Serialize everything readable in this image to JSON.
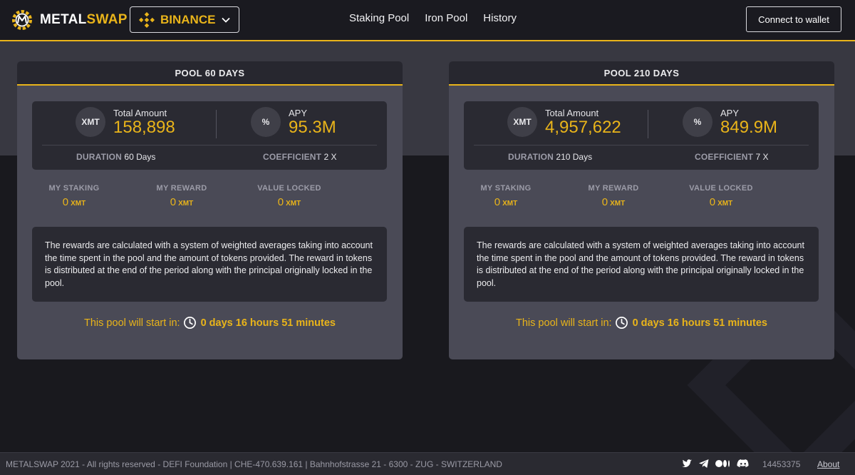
{
  "brand": {
    "name_part1": "METAL",
    "name_part2": "SWAP",
    "accent_color": "#e9b41a"
  },
  "header": {
    "network_label": "BINANCE",
    "nav": [
      {
        "label": "Staking Pool"
      },
      {
        "label": "Iron Pool"
      },
      {
        "label": "History"
      }
    ],
    "wallet_label": "Connect to wallet"
  },
  "pools": [
    {
      "title": "POOL 60 DAYS",
      "token": "XMT",
      "total_label": "Total Amount",
      "total_value": "158,898",
      "apy_symbol": "%",
      "apy_label": "APY",
      "apy_value": "95.3M",
      "duration_label": "DURATION",
      "duration_value": "60 Days",
      "coefficient_label": "COEFFICIENT",
      "coefficient_value": "2 X",
      "my_staking_label": "MY STAKING",
      "my_staking_value": "0",
      "my_reward_label": "MY REWARD",
      "my_reward_value": "0",
      "value_locked_label": "VALUE LOCKED",
      "value_locked_value": "0",
      "unit": "XMT",
      "description": "The rewards are calculated with a system of weighted averages taking into account the time spent in the pool and the amount of tokens provided. The reward in tokens is distributed at the end of the period along with the principal originally locked in the pool.",
      "start_label": "This pool will start in:",
      "start_time": "0 days 16 hours 51 minutes"
    },
    {
      "title": "POOL 210 DAYS",
      "token": "XMT",
      "total_label": "Total Amount",
      "total_value": "4,957,622",
      "apy_symbol": "%",
      "apy_label": "APY",
      "apy_value": "849.9M",
      "duration_label": "DURATION",
      "duration_value": "210 Days",
      "coefficient_label": "COEFFICIENT",
      "coefficient_value": "7 X",
      "my_staking_label": "MY STAKING",
      "my_staking_value": "0",
      "my_reward_label": "MY REWARD",
      "my_reward_value": "0",
      "value_locked_label": "VALUE LOCKED",
      "value_locked_value": "0",
      "unit": "XMT",
      "description": "The rewards are calculated with a system of weighted averages taking into account the time spent in the pool and the amount of tokens provided. The reward in tokens is distributed at the end of the period along with the principal originally locked in the pool.",
      "start_label": "This pool will start in:",
      "start_time": "0 days 16 hours 51 minutes"
    }
  ],
  "footer": {
    "legal": "METALSWAP 2021 - All rights reserved - DEFI Foundation | CHE-470.639.161 | Bahnhofstrasse 21 - 6300 - ZUG - SWITZERLAND",
    "social_icons": [
      "twitter-icon",
      "telegram-icon",
      "medium-icon",
      "discord-icon"
    ],
    "counter": "14453375",
    "about_label": "About"
  }
}
